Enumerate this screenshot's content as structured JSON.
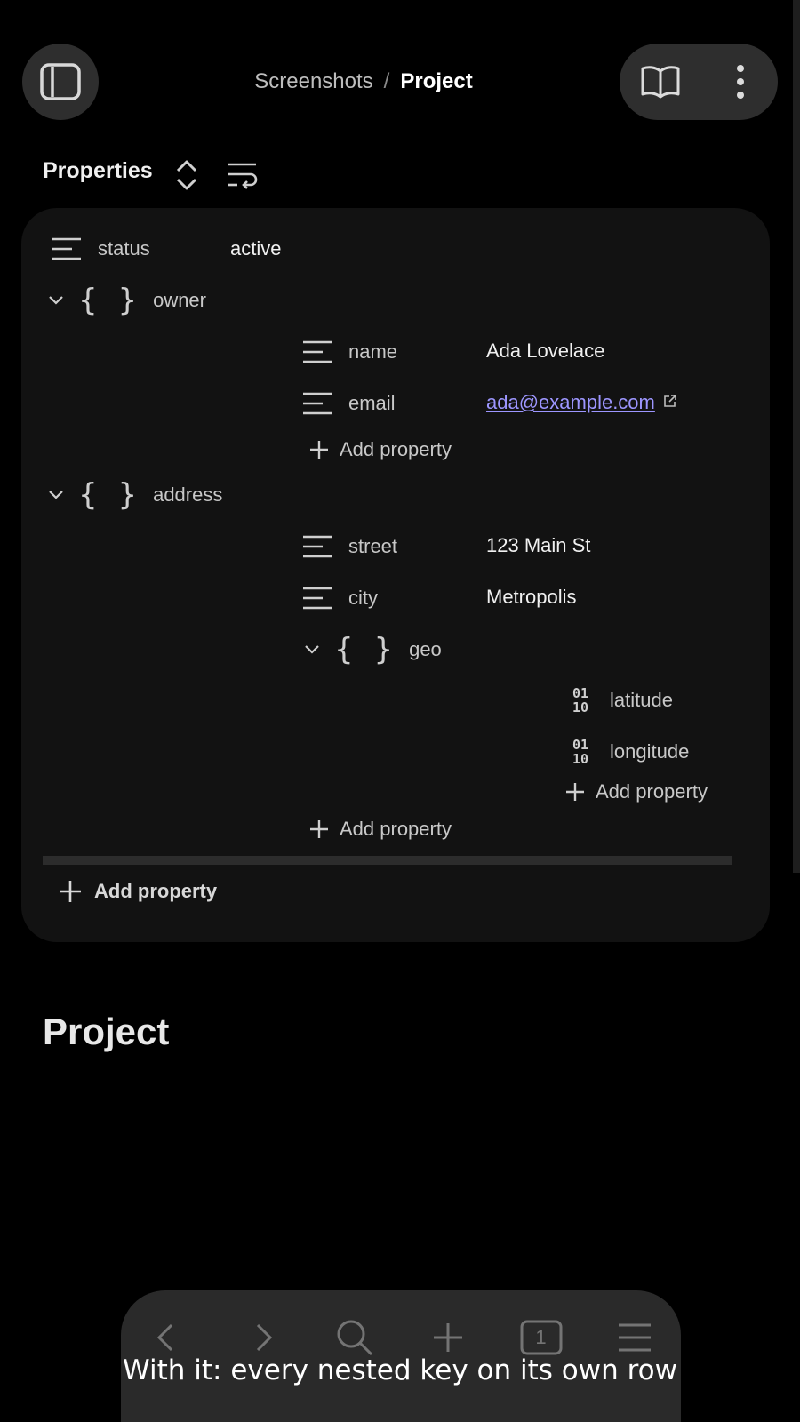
{
  "breadcrumb": {
    "parent": "Screenshots",
    "separator": "/",
    "current": "Project"
  },
  "properties": {
    "title": "Properties",
    "rows": {
      "status": {
        "key": "status",
        "value": "active"
      },
      "owner": {
        "key": "owner"
      },
      "name": {
        "key": "name",
        "value": "Ada Lovelace"
      },
      "email": {
        "key": "email",
        "value": "ada@example.com"
      },
      "address": {
        "key": "address"
      },
      "street": {
        "key": "street",
        "value": "123 Main St"
      },
      "city": {
        "key": "city",
        "value": "Metropolis"
      },
      "geo": {
        "key": "geo"
      },
      "latitude": {
        "key": "latitude"
      },
      "longitude": {
        "key": "longitude"
      }
    },
    "add_property_label": "Add property",
    "binary_icon_text": {
      "top": "01",
      "bottom": "10"
    }
  },
  "page": {
    "title": "Project"
  },
  "bottom_nav": {
    "tab_count": "1"
  },
  "caption": "With it: every nested key on its own row",
  "colors": {
    "background": "#000000",
    "panel": "#121212",
    "link": "#9d96ff",
    "pill": "#2e2e2e"
  }
}
